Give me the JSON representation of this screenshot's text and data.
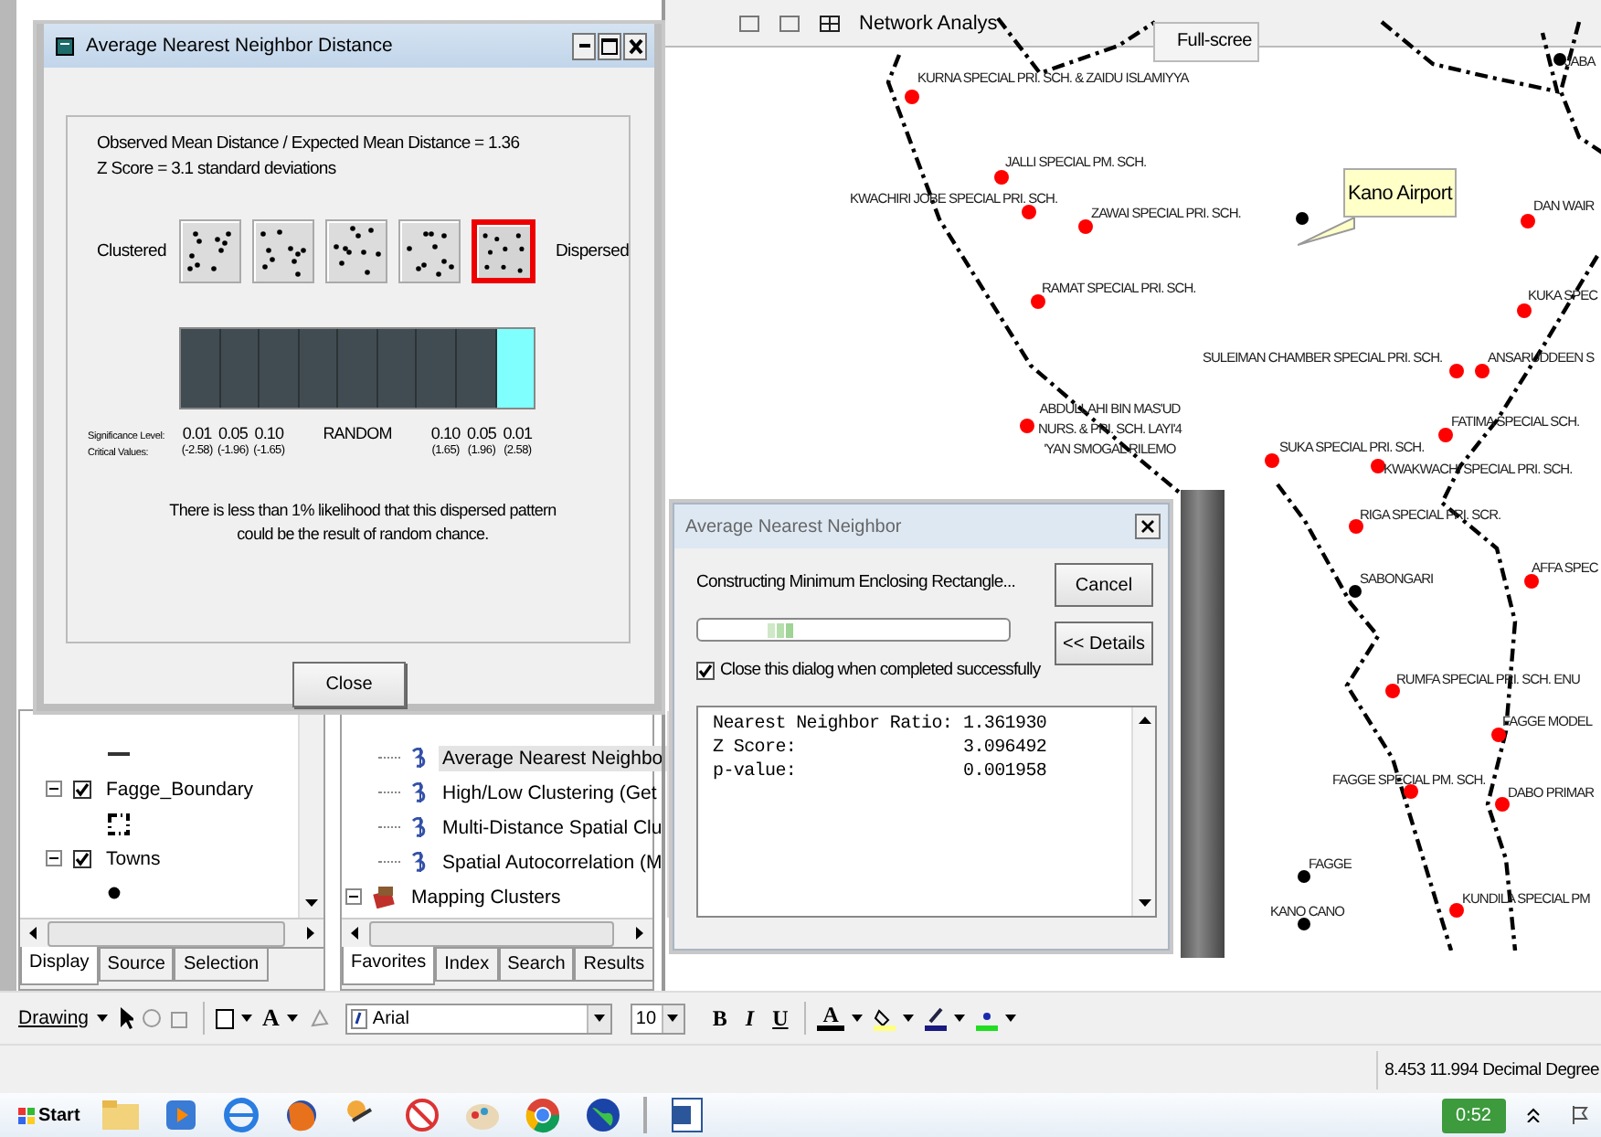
{
  "map": {
    "toolbar": {
      "label": "Network Analys",
      "tooltip": "Full-scree"
    },
    "callout": "Kano Airport",
    "places": [
      {
        "label": "KURNA SPECIAL PRI. SCH. & ZAIDU ISLAMIYYA",
        "kind": "school"
      },
      {
        "label": "JABA",
        "kind": "town"
      },
      {
        "label": "JALLI SPECIAL PM. SCH.",
        "kind": "school"
      },
      {
        "label": "KWACHIRI JOBE SPECIAL PRI. SCH.",
        "kind": "school"
      },
      {
        "label": "ZAWAI SPECIAL PRI. SCH.",
        "kind": "school"
      },
      {
        "label": "DAN WAIR",
        "kind": "school"
      },
      {
        "label": "RAMAT SPECIAL PRI. SCH.",
        "kind": "school"
      },
      {
        "label": "KUKA SPEC",
        "kind": "school"
      },
      {
        "label": "SULEIMAN CHAMBER SPECIAL PRI. SCH.",
        "kind": "school"
      },
      {
        "label": "ANSARUDDEEN S",
        "kind": "school"
      },
      {
        "label": "ABDULLAHI BIN MAS'UD\nNURS. & PRI. SCH. LAYI'4\n'YAN SMOGAL RILEMO",
        "kind": "school"
      },
      {
        "label": "FATIMA SPECIAL SCH.",
        "kind": "school"
      },
      {
        "label": "SUKA SPECIAL PRI. SCH.",
        "kind": "school"
      },
      {
        "label": "KWAKWACHI SPECIAL PRI. SCH.",
        "kind": "school"
      },
      {
        "label": "RIGA SPECIAL PRI. SCR.",
        "kind": "school"
      },
      {
        "label": "AFFA SPEC",
        "kind": "school"
      },
      {
        "label": "SABONGARI",
        "kind": "town"
      },
      {
        "label": "RUMFA SPECIAL PRI. SCH. ENU",
        "kind": "school"
      },
      {
        "label": "FAGGE MODEL",
        "kind": "school"
      },
      {
        "label": "FAGGE SPECIAL PM. SCH.",
        "kind": "school"
      },
      {
        "label": "DABO PRIMAR",
        "kind": "school"
      },
      {
        "label": "FAGGE",
        "kind": "town"
      },
      {
        "label": "KANO CANO",
        "kind": "town"
      },
      {
        "label": "KUNDILA SPECIAL PM",
        "kind": "school"
      }
    ]
  },
  "distance_dialog": {
    "title": "Average Nearest Neighbor Distance",
    "ratio_text": "Observed Mean Distance / Expected Mean Distance = 1.36",
    "zscore_text": "Z Score = 3.1 standard deviations",
    "left_label": "Clustered",
    "right_label": "Dispersed",
    "patterns": [
      {
        "selected": false
      },
      {
        "selected": false
      },
      {
        "selected": false
      },
      {
        "selected": false
      },
      {
        "selected": true
      }
    ],
    "segments": [
      {
        "selected": false
      },
      {
        "selected": false
      },
      {
        "selected": false
      },
      {
        "selected": false
      },
      {
        "selected": false
      },
      {
        "selected": false
      },
      {
        "selected": false
      },
      {
        "selected": false
      },
      {
        "selected": true
      }
    ],
    "significance_label": "Significance Level:",
    "critical_label": "Critical Values:",
    "scale": [
      {
        "significance": "0.01",
        "critical": "(-2.58)"
      },
      {
        "significance": "0.05",
        "critical": "(-1.96)"
      },
      {
        "significance": "0.10",
        "critical": "(-1.65)"
      },
      {
        "significance": "RANDOM"
      },
      {
        "significance": "0.10",
        "critical": "(1.65)"
      },
      {
        "significance": "0.05",
        "critical": "(1.96)"
      },
      {
        "significance": "0.01",
        "critical": "(2.58)"
      }
    ],
    "message": "There is less than 1% likelihood that this dispersed pattern\ncould be the result of random chance.",
    "close_button": "Close"
  },
  "progress_dialog": {
    "title": "Average Nearest Neighbor",
    "status": "Constructing Minimum Enclosing Rectangle...",
    "buttons": [
      "Cancel",
      "<< Details"
    ],
    "close_when_done": {
      "label": "Close this dialog when completed successfully",
      "checked": true
    },
    "results": [
      {
        "name": "Nearest Neighbor Ratio:",
        "value": "1.361930"
      },
      {
        "name": "Z Score:",
        "value": "3.096492"
      },
      {
        "name": "p-value:",
        "value": "0.001958"
      }
    ]
  },
  "table_of_contents": {
    "layers": [
      {
        "name": "Fagge_Boundary",
        "checked": true,
        "expanded": true,
        "kind": "boundary"
      },
      {
        "name": "Towns",
        "checked": true,
        "expanded": true,
        "kind": "point"
      }
    ],
    "tabs": [
      {
        "label": "Display",
        "selected": true
      },
      {
        "label": "Source",
        "selected": false
      },
      {
        "label": "Selection",
        "selected": false
      }
    ]
  },
  "toolbox": {
    "tools": [
      {
        "label": "Average Nearest Neighbo",
        "selected": true
      },
      {
        "label": "High/Low Clustering (Get",
        "selected": false
      },
      {
        "label": "Multi-Distance Spatial Clu",
        "selected": false
      },
      {
        "label": "Spatial Autocorrelation (M",
        "selected": false
      }
    ],
    "toolset": {
      "label": "Mapping Clusters",
      "expanded": true
    },
    "tabs": [
      {
        "label": "Favorites",
        "selected": true
      },
      {
        "label": "Index",
        "selected": false
      },
      {
        "label": "Search",
        "selected": false
      },
      {
        "label": "Results",
        "selected": false
      }
    ]
  },
  "drawing_toolbar": {
    "menu": "Drawing",
    "text_tool": "A",
    "font": "Arial",
    "size": "10",
    "bold": "B",
    "italic": "I",
    "underline": "U",
    "font_color": "A"
  },
  "status_bar": {
    "coordinates": "8.453  11.994 Decimal Degree"
  },
  "taskbar": {
    "start": "Start",
    "clock": "0:52"
  }
}
